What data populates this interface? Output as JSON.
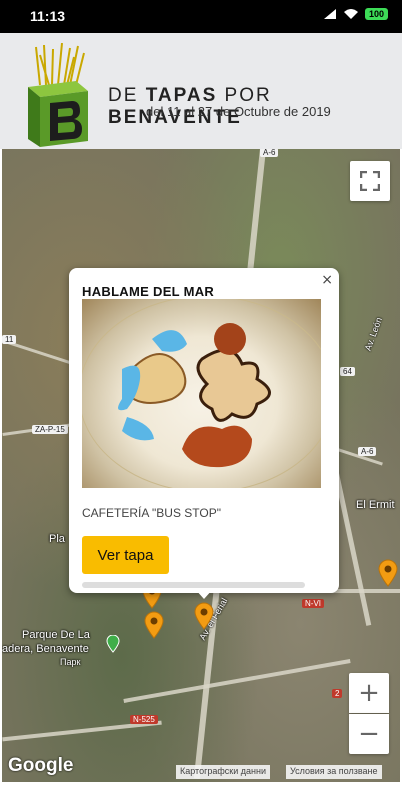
{
  "status_bar": {
    "time": "11:13",
    "battery": "100"
  },
  "header": {
    "title_prefix": "DE ",
    "title_word1": "TAPAS",
    "title_mid": " POR ",
    "title_word2": "BENAVENTE",
    "subtitle": "del 11 al 27 de Octubre de 2019"
  },
  "map": {
    "labels": {
      "a6_top": "A-6",
      "route_11": "11",
      "route_64": "64",
      "a6_mid": "A-6",
      "za_p": "ZA-P-15",
      "av_leon": "Av. León",
      "el_ermita": "El Ermit",
      "pla": "Pla",
      "nvi": "N-VI",
      "route_2": "2",
      "n525": "N-525",
      "park_line1": "Parque De La",
      "park_line2": "adera, Benavente",
      "park_sub": "Парк",
      "av_feria": "Av. el Ferial"
    },
    "google": "Google",
    "attribution_data": "Картографски данни",
    "attribution_terms": "Условия за ползване"
  },
  "info_window": {
    "title": "HABLAME DEL MAR",
    "place": "CAFETERÍA \"BUS STOP\"",
    "button": "Ver tapa",
    "close": "×"
  },
  "colors": {
    "accent": "#f9bc00",
    "pin": "#f39c12"
  }
}
